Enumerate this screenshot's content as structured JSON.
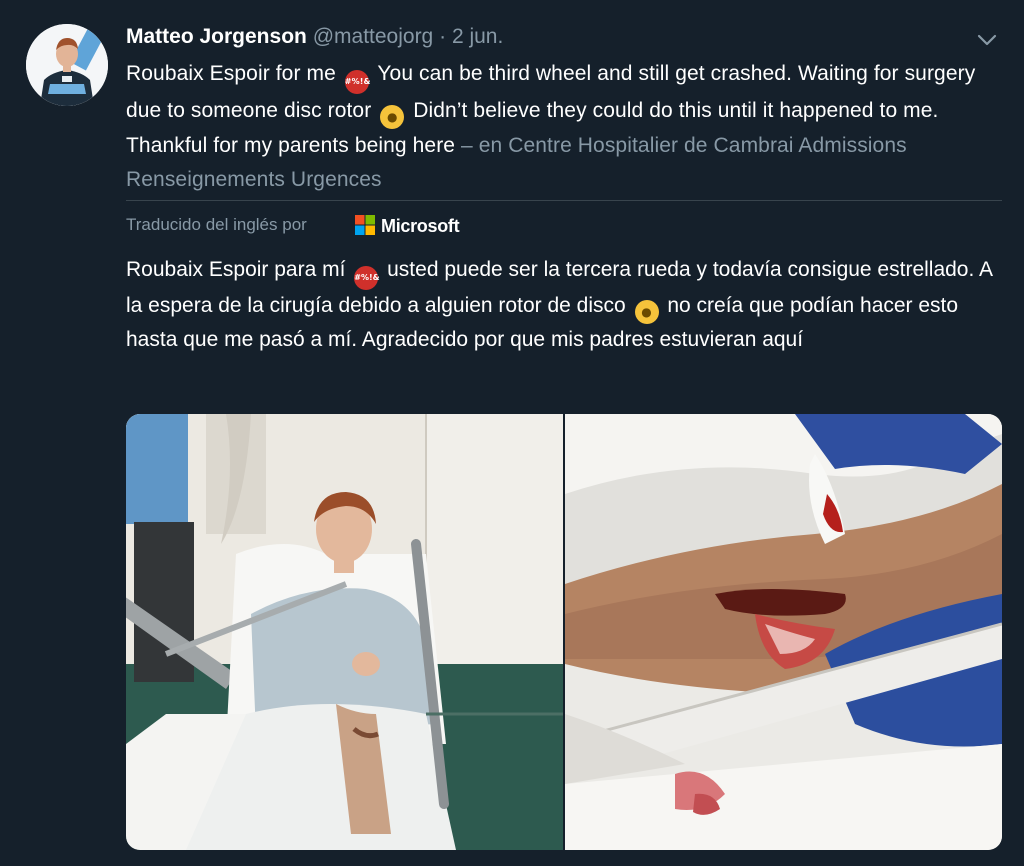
{
  "tweet": {
    "author_name": "Matteo Jorgenson",
    "author_handle": "@matteojorg",
    "separator": "·",
    "date": "2 jun.",
    "text_part1": "Roubaix Espoir for me",
    "text_part2": "You can be third wheel and still get crashed. Waiting for surgery due to someone disc rotor",
    "text_part3": "Didn’t believe they could do this until it happened to me. Thankful for my parents being here",
    "location": "– en Centre Hospitalier de Cambrai Admissions Renseignements Urgences",
    "translated_label": "Traducido del inglés por",
    "translator_name": "Microsoft",
    "translation_part1": "Roubaix Espoir para mí",
    "translation_part2": "usted puede ser la tercera rueda y todavía consigue estrellado. A la espera de la cirugía debido a alguien rotor de disco",
    "translation_part3": "no creía que podían hacer esto hasta que me pasó a mí. Agradecido por que mis padres estuvieran aquí",
    "emoji_symbols": "#%!&"
  },
  "icons": {
    "menu": "chevron-down-icon",
    "emoji_angry": "face-with-symbols-emoji",
    "emoji_huff": "face-with-steam-emoji",
    "translator_logo": "microsoft-logo"
  },
  "colors": {
    "background": "#15202b",
    "secondary_text": "#8899a6",
    "primary_text": "#ffffff",
    "divider": "#38444d"
  }
}
